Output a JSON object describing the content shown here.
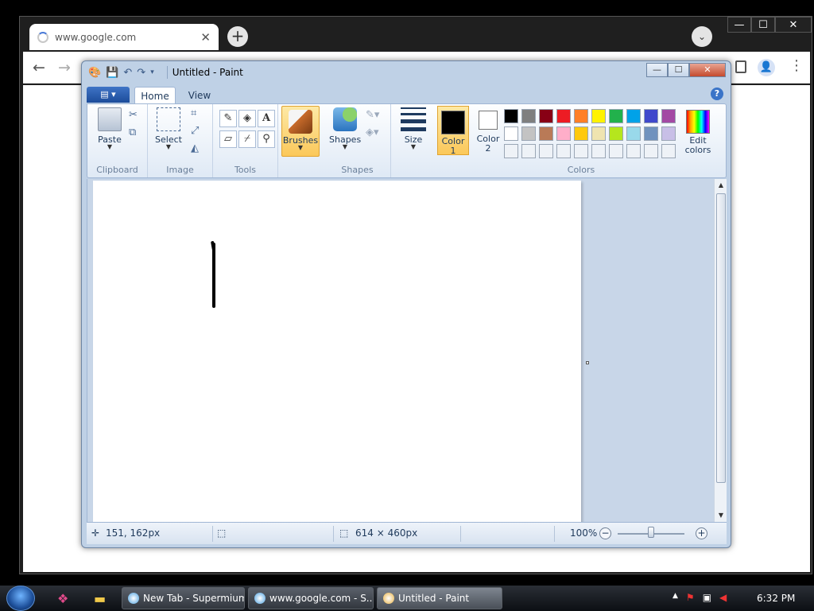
{
  "browser": {
    "tab_title": "www.google.com",
    "tab_close": "✕",
    "new_tab": "+",
    "nav_back": "←",
    "nav_forward": "→",
    "menu_dots": "⋮",
    "profile_glyph": "👤",
    "tab_menu": "⌄"
  },
  "window_controls": {
    "minimize": "—",
    "maximize": "☐",
    "close": "✕"
  },
  "paint": {
    "title": "Untitled - Paint",
    "tabs": {
      "home": "Home",
      "view": "View"
    },
    "file_menu": "▤ ▾",
    "help": "?",
    "groups": {
      "clipboard": "Clipboard",
      "image": "Image",
      "tools": "Tools",
      "shapes": "Shapes",
      "colors": "Colors"
    },
    "buttons": {
      "paste": "Paste",
      "select": "Select",
      "brushes": "Brushes",
      "shapes": "Shapes",
      "size": "Size",
      "color1": "Color 1",
      "color2": "Color 2",
      "edit_colors": "Edit colors"
    },
    "color1_value": "#000000",
    "color2_value": "#ffffff",
    "palette": [
      "#000000",
      "#7f7f7f",
      "#880015",
      "#ed1c24",
      "#ff7f27",
      "#fff200",
      "#22b14c",
      "#00a2e8",
      "#3f48cc",
      "#a349a4",
      "#ffffff",
      "#c3c3c3",
      "#b97a57",
      "#ffaec9",
      "#ffc90e",
      "#efe4b0",
      "#b5e61d",
      "#99d9ea",
      "#7092be",
      "#c8bfe7",
      "#eef2f7",
      "#eef2f7",
      "#eef2f7",
      "#eef2f7",
      "#eef2f7",
      "#eef2f7",
      "#eef2f7",
      "#eef2f7",
      "#eef2f7",
      "#eef2f7"
    ],
    "status": {
      "cursor_pos": "151, 162px",
      "canvas_size": "614 × 460px",
      "zoom": "100%",
      "zoom_minus": "−",
      "zoom_plus": "+"
    }
  },
  "taskbar": {
    "items": [
      {
        "label": "New Tab - Supermium"
      },
      {
        "label": "www.google.com - S..."
      },
      {
        "label": "Untitled - Paint"
      }
    ],
    "clock": "6:32 PM",
    "tray_arrow": "▲"
  }
}
